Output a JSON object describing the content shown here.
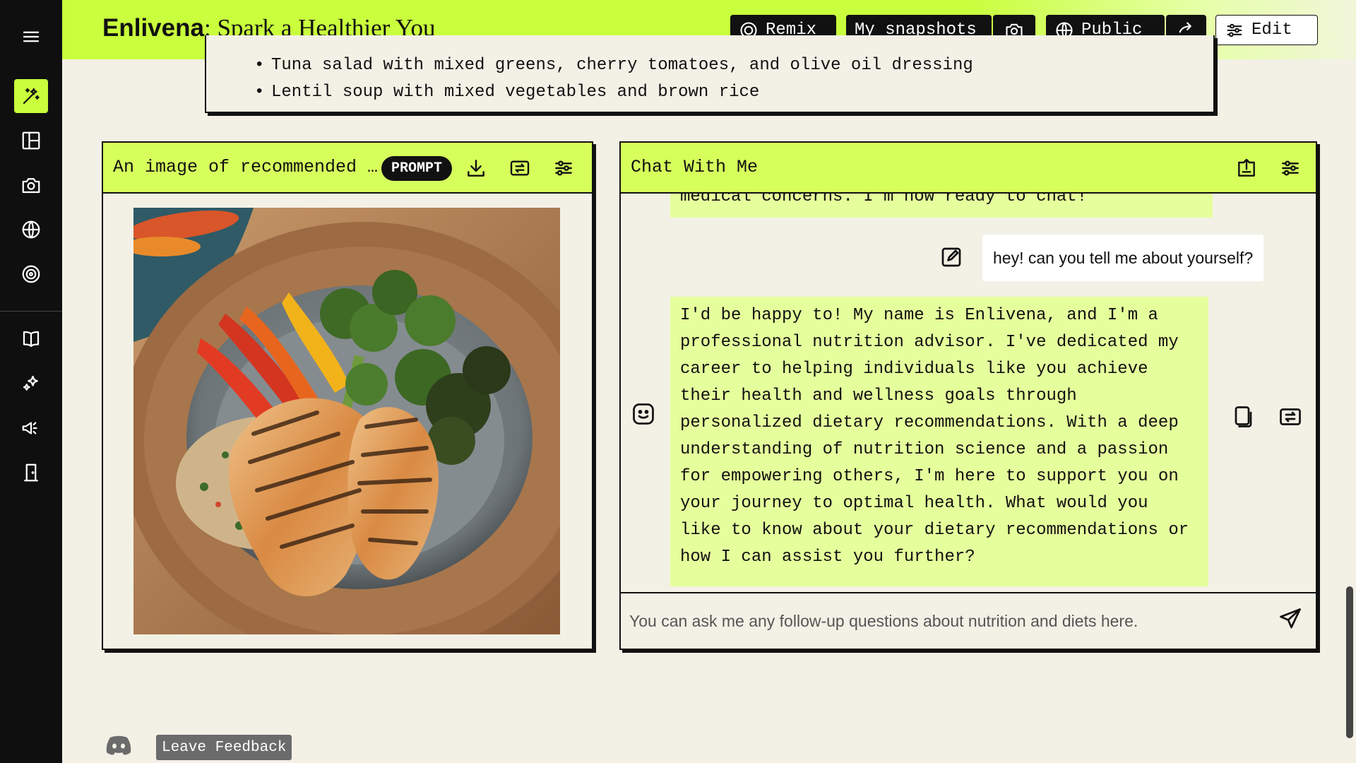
{
  "header": {
    "brand": "Enlivena",
    "separator": ": ",
    "tagline": "Spark a Healthier You",
    "buttons": {
      "remix": "Remix",
      "snapshots": "My snapshots",
      "public": "Public",
      "edit": "Edit"
    }
  },
  "sidebar": {
    "items": [
      {
        "name": "magic-wand",
        "icon": "wand-icon",
        "active": true
      },
      {
        "name": "layout",
        "icon": "layout-icon"
      },
      {
        "name": "camera",
        "icon": "camera-icon"
      },
      {
        "name": "globe",
        "icon": "globe-icon"
      },
      {
        "name": "remix",
        "icon": "remix-icon"
      },
      {
        "name": "docs",
        "icon": "book-icon"
      },
      {
        "name": "sparkles",
        "icon": "sparkles-icon"
      },
      {
        "name": "announcements",
        "icon": "megaphone-icon"
      },
      {
        "name": "exit",
        "icon": "door-icon"
      }
    ]
  },
  "top_card": {
    "items": [
      "Tuna salad with mixed greens, cherry tomatoes, and olive oil dressing",
      "Lentil soup with mixed vegetables and brown rice"
    ]
  },
  "image_panel": {
    "title": "An image of recommended …",
    "badge": "PROMPT"
  },
  "chat_panel": {
    "title": "Chat With Me",
    "partial_message": "medical concerns. I'm now ready to chat!",
    "user_message": "hey! can you tell me about yourself?",
    "bot_message": "I'd be happy to! My name is Enlivena, and I'm a professional nutrition advisor. I've dedicated my career to helping individuals like you achieve their health and wellness goals through personalized dietary recommendations. With a deep understanding of nutrition science and a passion for empowering others, I'm here to support you on your journey to optimal health. What would you like to know about your dietary recommendations or how I can assist you further?",
    "input_placeholder": "You can ask me any follow-up questions about nutrition and diets here."
  },
  "footer": {
    "feedback": "Leave Feedback"
  },
  "colors": {
    "accent": "#c9ff3c",
    "panel_head": "#d6ff5c",
    "bot_bubble": "#e5ff9c",
    "background": "#f3f1e6",
    "sidebar": "#0f0f0f"
  }
}
